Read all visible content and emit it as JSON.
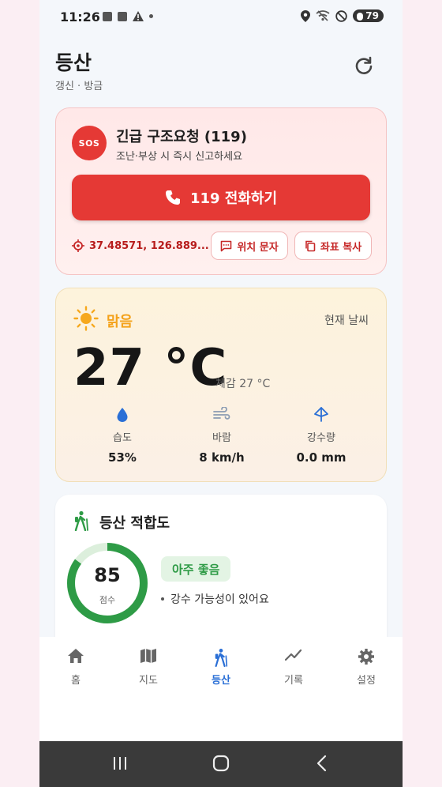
{
  "status_bar": {
    "time": "11:26",
    "battery": "79"
  },
  "header": {
    "title": "등산",
    "subtitle": "갱신 · 방금"
  },
  "sos": {
    "badge": "SOS",
    "title": "긴급 구조요청 (119)",
    "description": "조난·부상 시 즉시 신고하세요",
    "call_label": "119 전화하기",
    "coords": "37.48571, 126.889...",
    "sms_label": "위치 문자",
    "copy_label": "좌표 복사"
  },
  "weather": {
    "condition": "맑음",
    "label": "현재 날씨",
    "temperature": "27 °C",
    "feels_like": "체감 27 °C",
    "stats": [
      {
        "label": "습도",
        "value": "53%"
      },
      {
        "label": "바람",
        "value": "8 km/h"
      },
      {
        "label": "강수량",
        "value": "0.0 mm"
      }
    ]
  },
  "suitability": {
    "title": "등산 적합도",
    "score": "85",
    "score_label": "점수",
    "score_fraction": 0.85,
    "grade": "아주 좋음",
    "note": "강수 가능성이 있어요"
  },
  "nav": {
    "items": [
      {
        "label": "홈"
      },
      {
        "label": "지도"
      },
      {
        "label": "등산"
      },
      {
        "label": "기록"
      },
      {
        "label": "설정"
      }
    ],
    "active": 2
  },
  "colors": {
    "accent": "#2a6fd6",
    "danger": "#e53935",
    "good": "#2e9b46",
    "sun": "#f4a21b"
  }
}
